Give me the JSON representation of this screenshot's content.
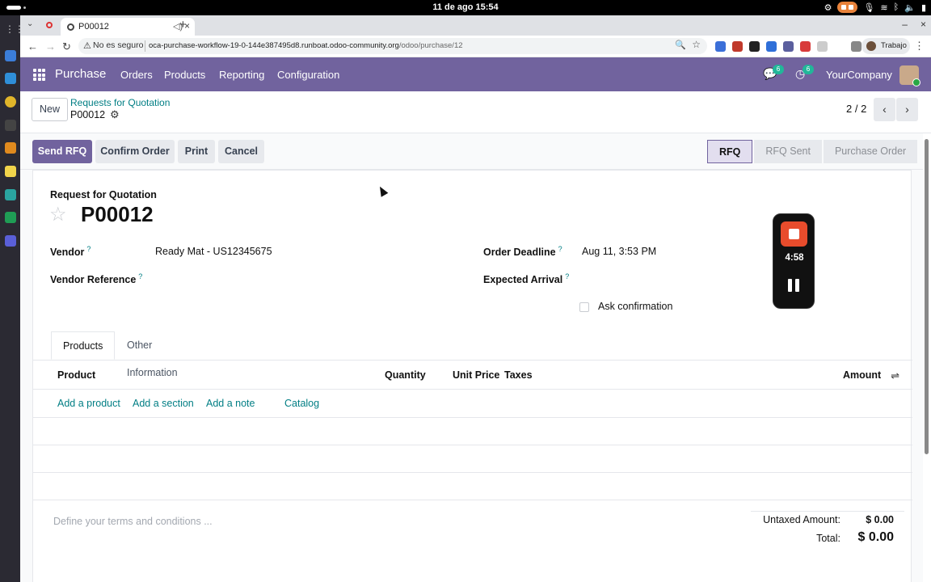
{
  "os": {
    "clock": "11 de ago  15:54"
  },
  "browser": {
    "tab_title": "P00012",
    "security_label": "No es seguro",
    "url_host": "oca-purchase-workflow-19-0-144e387495d8.runboat.odoo-community.org",
    "url_path": "/odoo/purchase/12",
    "profile_label": "Trabajo"
  },
  "navbar": {
    "app_name": "Purchase",
    "menu": [
      "Orders",
      "Products",
      "Reporting",
      "Configuration"
    ],
    "messages_badge": "6",
    "activity_badge": "6",
    "company": "YourCompany"
  },
  "control_panel": {
    "new_label": "New",
    "breadcrumb_parent": "Requests for Quotation",
    "breadcrumb_current": "P00012",
    "pager": "2 / 2"
  },
  "status_bar": {
    "buttons": [
      "Send RFQ",
      "Confirm Order",
      "Print",
      "Cancel"
    ],
    "stages": [
      "RFQ",
      "RFQ Sent",
      "Purchase Order"
    ],
    "active_stage": "RFQ"
  },
  "form": {
    "doc_type": "Request for Quotation",
    "name": "P00012",
    "fields": {
      "vendor_label": "Vendor",
      "vendor_value": "Ready Mat - US12345675",
      "vendor_ref_label": "Vendor Reference",
      "order_deadline_label": "Order Deadline",
      "order_deadline_value": "Aug 11, 3:53 PM",
      "expected_arrival_label": "Expected Arrival",
      "ask_confirmation_label": "Ask confirmation",
      "help_mark": "?"
    },
    "tabs": [
      "Products",
      "Other Information"
    ],
    "table": {
      "columns": [
        "Product",
        "Quantity",
        "Unit Price",
        "Taxes",
        "Amount"
      ],
      "add_links": [
        "Add a product",
        "Add a section",
        "Add a note",
        "Catalog"
      ]
    },
    "terms_placeholder": "Define your terms and conditions ...",
    "totals": {
      "untaxed_label": "Untaxed Amount:",
      "untaxed_value": "$ 0.00",
      "total_label": "Total:",
      "total_value": "$ 0.00"
    }
  },
  "recorder": {
    "time": "4:58"
  }
}
